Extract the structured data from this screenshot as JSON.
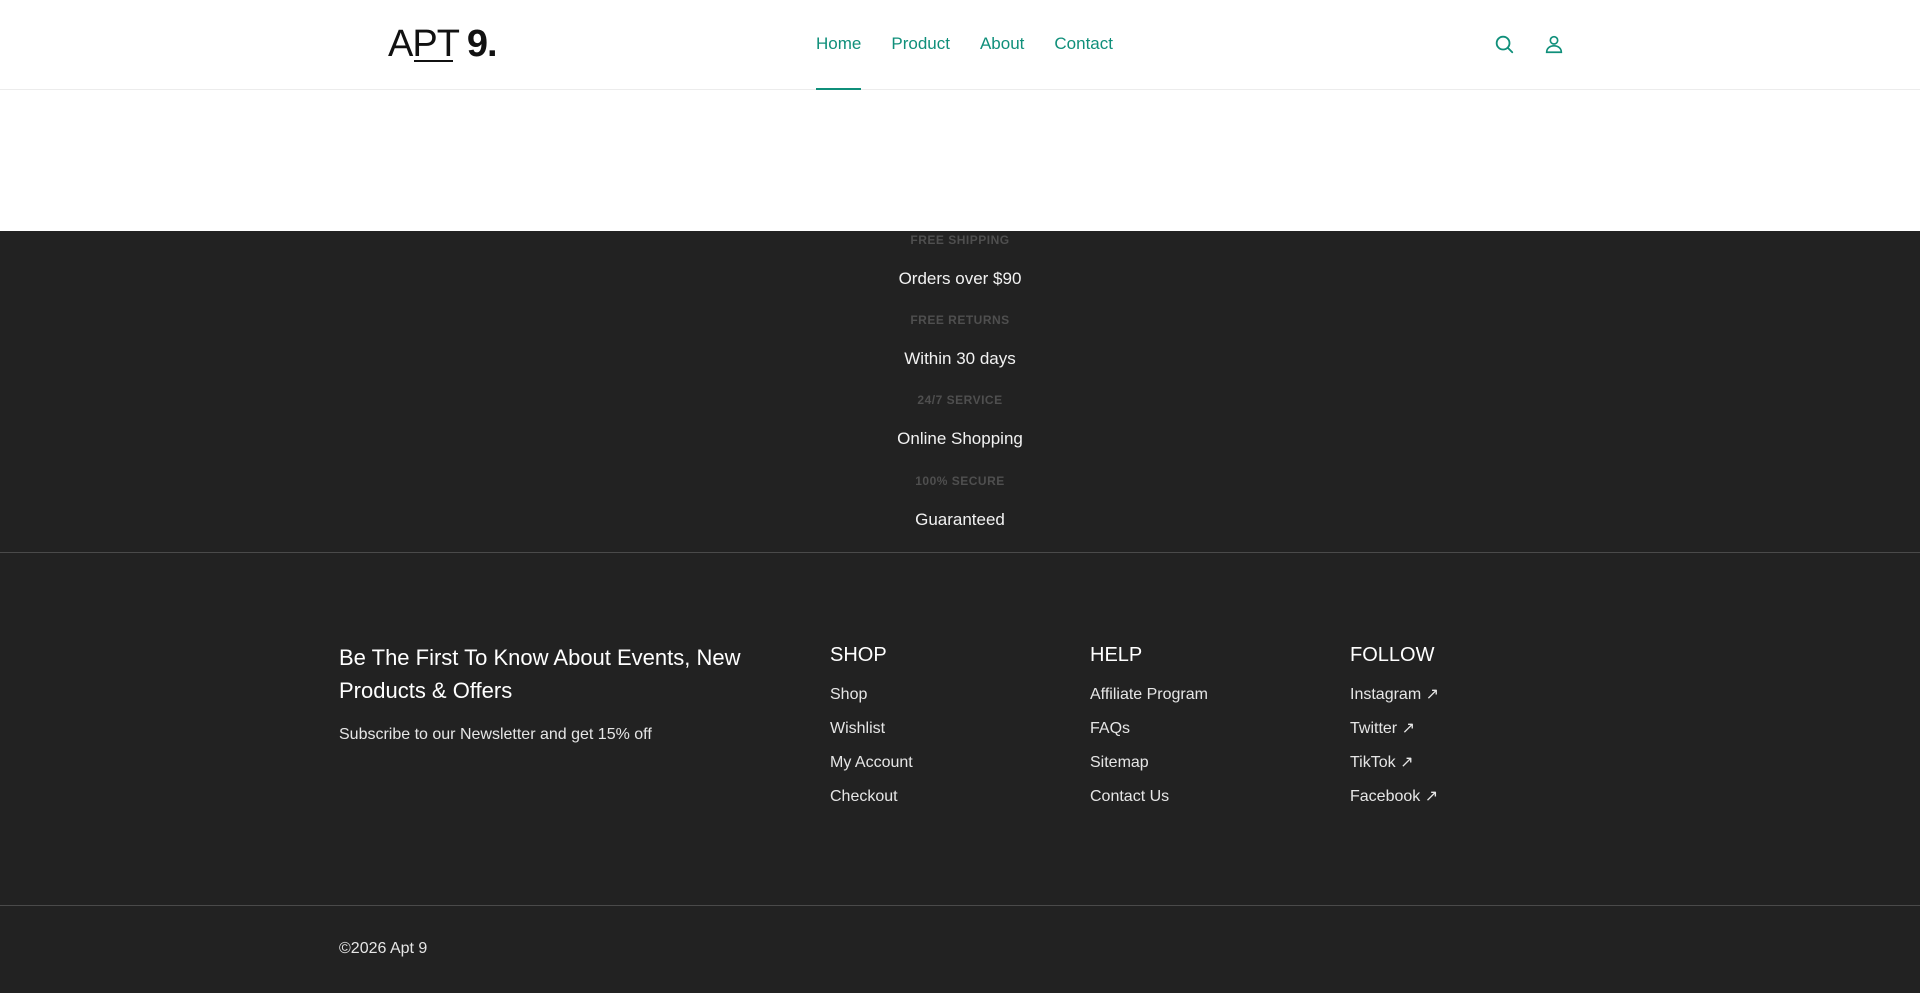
{
  "brand": {
    "logo_text_a": "APT",
    "logo_text_b": "9."
  },
  "nav": {
    "items": [
      {
        "label": "Home",
        "active": true
      },
      {
        "label": "Product"
      },
      {
        "label": "About"
      },
      {
        "label": "Contact"
      }
    ]
  },
  "icons": {
    "search": "search-icon",
    "account": "user-icon",
    "accent_color": "#0f8f7a"
  },
  "features": [
    {
      "eyebrow": "FREE SHIPPING",
      "text": "Orders over $90"
    },
    {
      "eyebrow": "FREE RETURNS",
      "text": "Within 30 days"
    },
    {
      "eyebrow": "24/7 SERVICE",
      "text": "Online Shopping"
    },
    {
      "eyebrow": "100% SECURE",
      "text": "Guaranteed"
    }
  ],
  "newsletter": {
    "title": "Be The First To Know About Events, New Products & Offers",
    "subtitle": "Subscribe to our Newsletter and get 15% off"
  },
  "columns": [
    {
      "heading": "SHOP",
      "links": [
        "Shop",
        "Wishlist",
        "My Account",
        "Checkout"
      ]
    },
    {
      "heading": "HELP",
      "links": [
        "Affiliate Program",
        "FAQs",
        "Sitemap",
        "Contact Us"
      ]
    },
    {
      "heading": "FOLLOW",
      "links": [
        "Instagram ↗",
        "Twitter ↗",
        "TikTok ↗",
        "Facebook ↗"
      ]
    }
  ],
  "copyright": "©2026 Apt 9"
}
